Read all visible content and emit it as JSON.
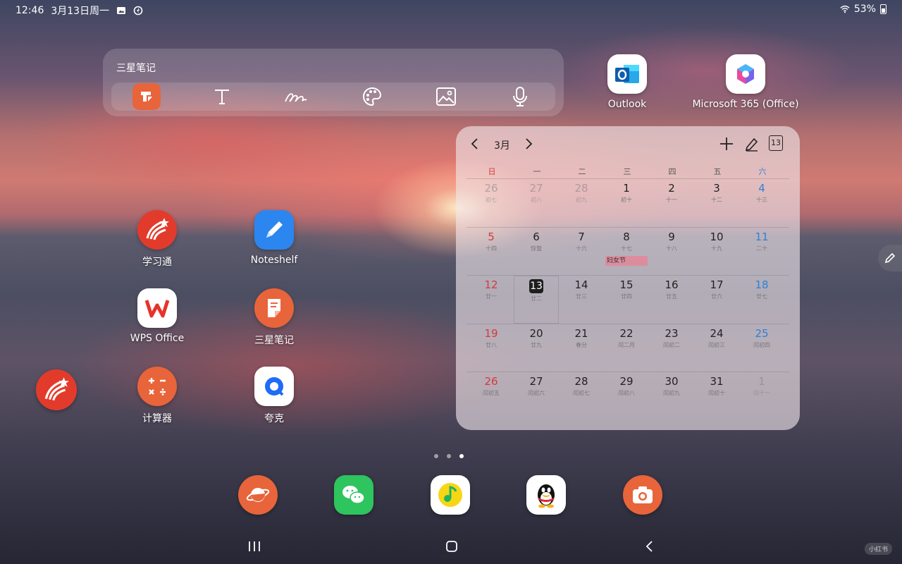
{
  "status_bar": {
    "time": "12:46",
    "date": "3月13日周一",
    "battery": "53%"
  },
  "notes_widget": {
    "title": "三星笔记"
  },
  "home_apps": [
    {
      "name": "Outlook"
    },
    {
      "name": "Microsoft 365 (Office)"
    },
    {
      "name": "学习通"
    },
    {
      "name": "Noteshelf"
    },
    {
      "name": "WPS Office"
    },
    {
      "name": "三星笔记"
    },
    {
      "name": "计算器"
    },
    {
      "name": "夸克"
    }
  ],
  "calendar": {
    "month": "3月",
    "today_button": "13",
    "weekdays": [
      "日",
      "一",
      "二",
      "三",
      "四",
      "五",
      "六"
    ],
    "weeks": [
      [
        {
          "d": "26",
          "l": "初七"
        },
        {
          "d": "27",
          "l": "初八"
        },
        {
          "d": "28",
          "l": "初九"
        },
        {
          "d": "1",
          "l": "初十"
        },
        {
          "d": "2",
          "l": "十一"
        },
        {
          "d": "3",
          "l": "十二"
        },
        {
          "d": "4",
          "l": "十三"
        }
      ],
      [
        {
          "d": "5",
          "l": "十四"
        },
        {
          "d": "6",
          "l": "惊蛰"
        },
        {
          "d": "7",
          "l": "十六"
        },
        {
          "d": "8",
          "l": "十七"
        },
        {
          "d": "9",
          "l": "十八"
        },
        {
          "d": "10",
          "l": "十九"
        },
        {
          "d": "11",
          "l": "二十"
        }
      ],
      [
        {
          "d": "12",
          "l": "廿一"
        },
        {
          "d": "13",
          "l": "廿二"
        },
        {
          "d": "14",
          "l": "廿三"
        },
        {
          "d": "15",
          "l": "廿四"
        },
        {
          "d": "16",
          "l": "廿五"
        },
        {
          "d": "17",
          "l": "廿六"
        },
        {
          "d": "18",
          "l": "廿七"
        }
      ],
      [
        {
          "d": "19",
          "l": "廿八"
        },
        {
          "d": "20",
          "l": "廿九"
        },
        {
          "d": "21",
          "l": "春分"
        },
        {
          "d": "22",
          "l": "闰二月"
        },
        {
          "d": "23",
          "l": "闰初二"
        },
        {
          "d": "24",
          "l": "闰初三"
        },
        {
          "d": "25",
          "l": "闰初四"
        }
      ],
      [
        {
          "d": "26",
          "l": "闰初五"
        },
        {
          "d": "27",
          "l": "闰初六"
        },
        {
          "d": "28",
          "l": "闰初七"
        },
        {
          "d": "29",
          "l": "闰初八"
        },
        {
          "d": "30",
          "l": "闰初九"
        },
        {
          "d": "31",
          "l": "闰初十"
        },
        {
          "d": "1",
          "l": "闰十一"
        }
      ]
    ],
    "event": "妇女节"
  },
  "watermark": "小红书"
}
